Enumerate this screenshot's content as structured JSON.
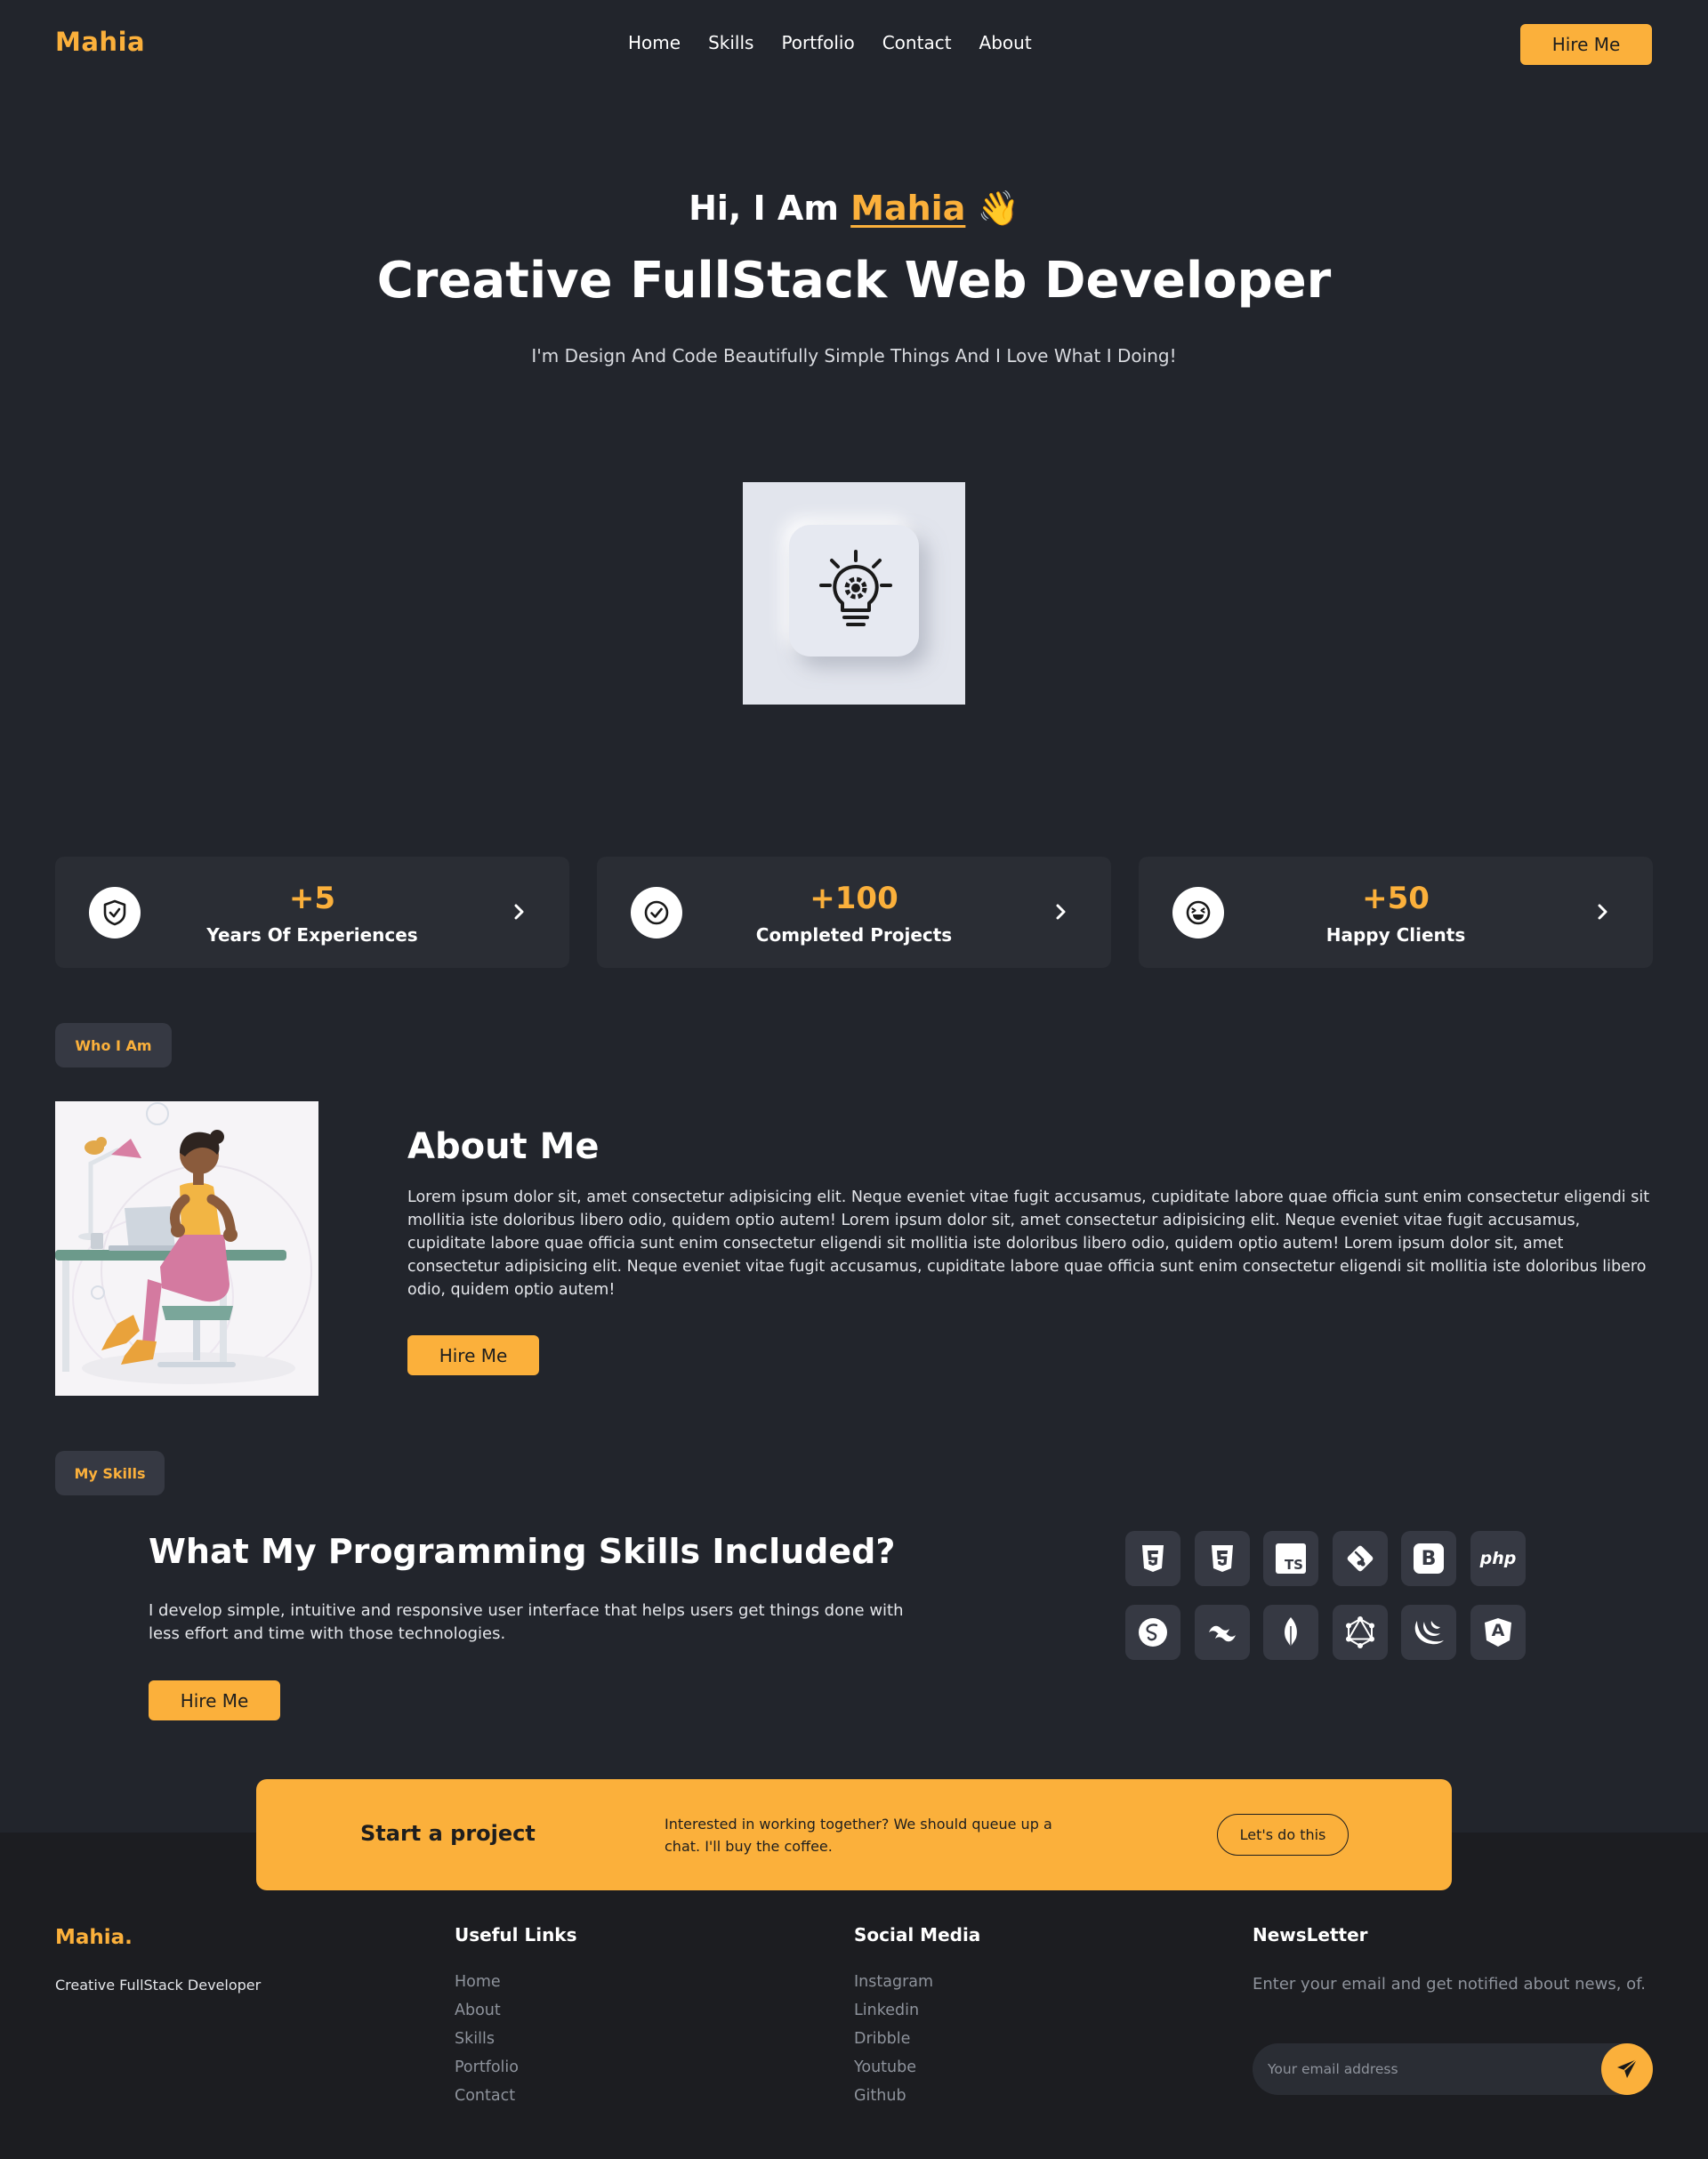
{
  "nav": {
    "logo": "Mahia",
    "links": [
      "Home",
      "Skills",
      "Portfolio",
      "Contact",
      "About"
    ],
    "hire_label": "Hire Me"
  },
  "hero": {
    "greeting": "Hi, I Am",
    "name": "Mahia",
    "wave": "👋",
    "title": "Creative FullStack Web Developer",
    "subtitle": "I'm Design And Code Beautifully Simple Things And I Love What I Doing!",
    "image_icon": "lightbulb-gear-icon"
  },
  "stats": [
    {
      "icon": "shield-check-icon",
      "value": "+5",
      "label": "Years Of Experiences"
    },
    {
      "icon": "check-circle-icon",
      "value": "+100",
      "label": "Completed Projects"
    },
    {
      "icon": "laughing-face-icon",
      "value": "+50",
      "label": "Happy Clients"
    }
  ],
  "about": {
    "badge": "Who I Am",
    "title": "About Me",
    "text": "Lorem ipsum dolor sit, amet consectetur adipisicing elit. Neque eveniet vitae fugit accusamus, cupiditate labore quae officia sunt enim consectetur eligendi sit mollitia iste doloribus libero odio, quidem optio autem! Lorem ipsum dolor sit, amet consectetur adipisicing elit. Neque eveniet vitae fugit accusamus, cupiditate labore quae officia sunt enim consectetur eligendi sit mollitia iste doloribus libero odio, quidem optio autem! Lorem ipsum dolor sit, amet consectetur adipisicing elit. Neque eveniet vitae fugit accusamus, cupiditate labore quae officia sunt enim consectetur eligendi sit mollitia iste doloribus libero odio, quidem optio autem!",
    "button": "Hire Me"
  },
  "skills": {
    "badge": "My Skills",
    "title": "What My Programming Skills Included?",
    "text": "I develop simple, intuitive and responsive user interface that helps users get things done with less effort and time with those technologies.",
    "button": "Hire Me",
    "icons": [
      "html5-icon",
      "css3-icon",
      "typescript-icon",
      "git-icon",
      "bootstrap-icon",
      "php-icon",
      "sass-icon",
      "tailwind-icon",
      "mongodb-icon",
      "graphql-icon",
      "jquery-icon",
      "angular-icon"
    ],
    "icon_text": {
      "typescript": "TS",
      "bootstrap": "B",
      "php": "php",
      "angular": "A"
    }
  },
  "cta": {
    "title": "Start a project",
    "text": "Interested in working together? We should queue up a chat. I'll buy the coffee.",
    "button": "Let's do this"
  },
  "footer": {
    "logo": "Mahia.",
    "tagline": "Creative FullStack Developer",
    "useful_links_title": "Useful Links",
    "useful_links": [
      "Home",
      "About",
      "Skills",
      "Portfolio",
      "Contact"
    ],
    "social_title": "Social Media",
    "social_links": [
      "Instagram",
      "Linkedin",
      "Dribble",
      "Youtube",
      "Github"
    ],
    "newsletter_title": "NewsLetter",
    "newsletter_text": "Enter your email and get notified about news, of.",
    "email_placeholder": "Your email address",
    "send_icon": "paper-plane-icon"
  },
  "colors": {
    "background": "#22252c",
    "card": "#2a2d34",
    "accent": "#fbb03b",
    "footer": "#1c1d21"
  }
}
